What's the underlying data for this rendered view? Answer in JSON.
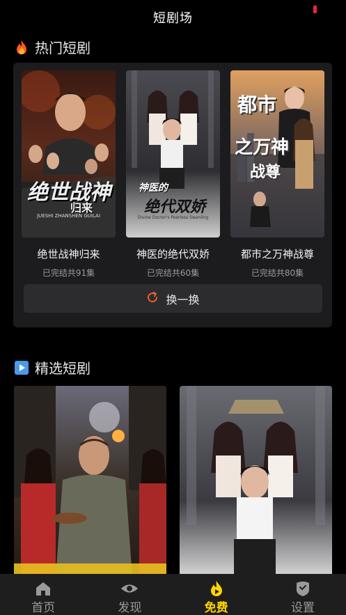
{
  "header": {
    "title": "短剧场"
  },
  "hot_section": {
    "title": "热门短剧",
    "icon": "fire-icon",
    "items": [
      {
        "name": "绝世战神归来",
        "meta": "已完结共91集",
        "poster_text": "绝世战神",
        "poster_text2": "归来",
        "poster_sub": "JUESHI ZHANSHEN GUILAI"
      },
      {
        "name": "神医的绝代双娇",
        "meta": "已完结共60集",
        "poster_text": "神医的",
        "poster_text2": "绝代双娇",
        "poster_sub": "Divine Doctor's Peerless Swanling"
      },
      {
        "name": "都市之万神战尊",
        "meta": "已完结共80集",
        "poster_text": "都市",
        "poster_text2": "之万神",
        "poster_sub": "战尊"
      }
    ],
    "refresh_label": "换一换"
  },
  "featured_section": {
    "title": "精选短剧",
    "icon": "play-icon"
  },
  "tabbar": {
    "items": [
      {
        "label": "首页",
        "icon": "home-icon",
        "active": false
      },
      {
        "label": "发现",
        "icon": "eye-icon",
        "active": false
      },
      {
        "label": "免费",
        "icon": "flame-icon",
        "active": true
      },
      {
        "label": "设置",
        "icon": "settings-icon",
        "active": false
      }
    ]
  },
  "colors": {
    "accent": "#ffd400",
    "refresh_icon": "#e8622a",
    "panel": "#1c1c1e"
  }
}
